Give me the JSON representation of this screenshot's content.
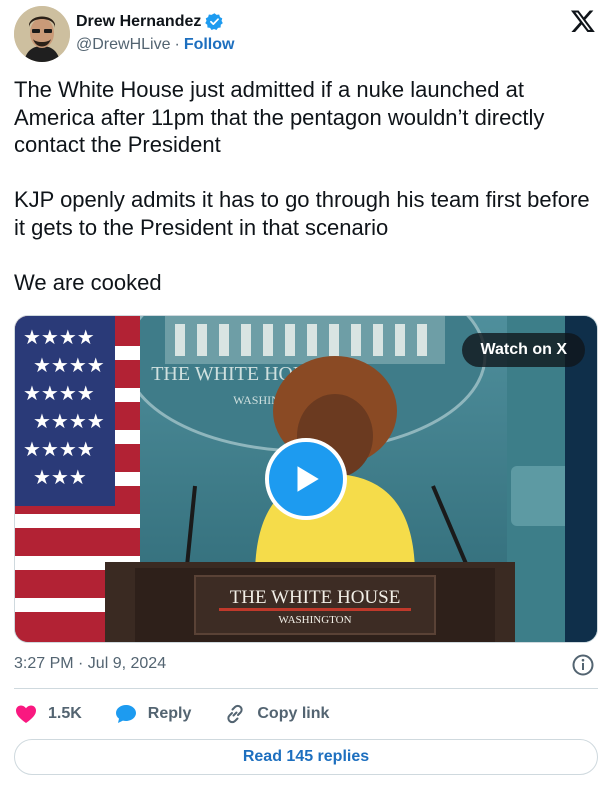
{
  "author": {
    "name": "Drew Hernandez",
    "handle": "@DrewHLive",
    "separator": "·",
    "follow_label": "Follow"
  },
  "tweet": {
    "text": "The White House just admitted if a nuke launched at America after 11pm that the pentagon wouldn’t directly contact the President\n\nKJP openly admits it has to go through his team first before it gets to the President in that scenario\n\nWe are cooked"
  },
  "media": {
    "watch_label": "Watch on X",
    "backdrop_seal_text": "THE WHITE HOUSE",
    "backdrop_seal_sub": "WASHINGTON",
    "podium_title": "THE WHITE HOUSE",
    "podium_sub": "WASHINGTON"
  },
  "meta": {
    "timestamp": "3:27 PM · Jul 9, 2024"
  },
  "actions": {
    "likes": "1.5K",
    "reply_label": "Reply",
    "copy_label": "Copy link"
  },
  "footer": {
    "read_replies_label": "Read 145 replies"
  },
  "colors": {
    "accent": "#1d9bf0",
    "link": "#1d6fbf",
    "like": "#f91880",
    "muted": "#536471"
  }
}
